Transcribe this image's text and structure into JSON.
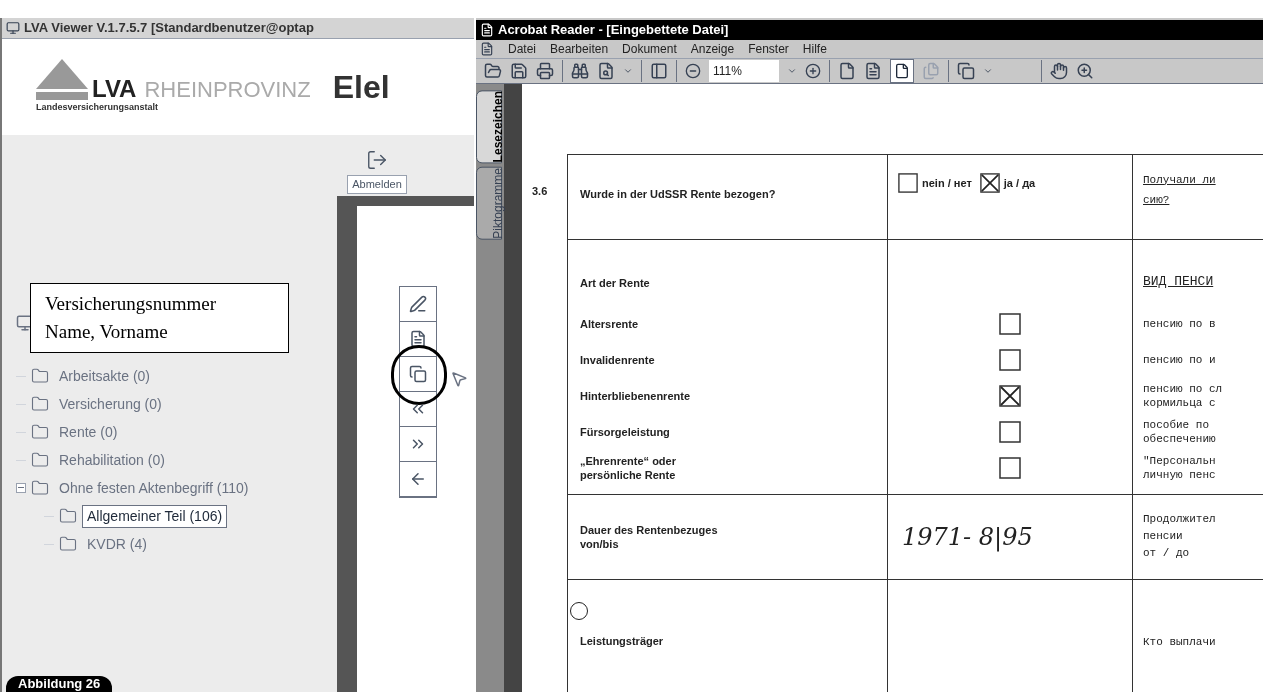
{
  "viewer": {
    "title": "LVA Viewer V.1.7.5.7 [Standardbenutzer@optap",
    "logo": {
      "brand": "LVA",
      "region": "RHEINPROVINZ",
      "subtitle": "Landesversicherungsanstalt"
    },
    "heading": "Elel",
    "logout_button": "Abmelden",
    "annotation": [
      "Versicherungsnummer",
      "Name, Vorname"
    ],
    "tree": [
      {
        "label": "Arbeitsakte (0)",
        "selected": false
      },
      {
        "label": "Versicherung (0)",
        "selected": false
      },
      {
        "label": "Rente (0)",
        "selected": false
      },
      {
        "label": "Rehabilitation (0)",
        "selected": false
      },
      {
        "label": "Ohne festen Aktenbegriff (110)",
        "selected": false,
        "expanded": true,
        "children": [
          {
            "label": "Allgemeiner Teil (106)",
            "selected": true
          },
          {
            "label": "KVDR (4)",
            "selected": false
          }
        ]
      }
    ],
    "tools": [
      {
        "kind": "edit",
        "circled": false
      },
      {
        "kind": "page",
        "circled": false
      },
      {
        "kind": "copy",
        "circled": true
      },
      {
        "kind": "rewind",
        "circled": false
      },
      {
        "kind": "forward",
        "circled": false
      },
      {
        "kind": "back",
        "circled": false
      }
    ]
  },
  "caption": "Abbildung 26",
  "reader": {
    "title": "Acrobat Reader - [Eingebettete Datei]",
    "menu": [
      "Datei",
      "Bearbeiten",
      "Dokument",
      "Anzeige",
      "Fenster",
      "Hilfe"
    ],
    "zoom": "111%",
    "side_tabs": [
      {
        "label": "Lesezeichen",
        "selected": true
      },
      {
        "label": "Piktogramme",
        "selected": false
      }
    ],
    "form": {
      "question": {
        "number": "3.6",
        "text": "Wurde in der UdSSR Rente bezogen?",
        "options": [
          {
            "label": "nein / нет",
            "checked": false
          },
          {
            "label": "ja / да",
            "checked": true
          }
        ],
        "russian": [
          "Получали ли",
          "сию?"
        ]
      },
      "pension_type": {
        "heading": "Art der Rente",
        "russian_heading": "ВИД ПЕНСИ",
        "options": [
          {
            "label": [
              "Altersrente"
            ],
            "checked": false,
            "russian": [
              "пенсию по в"
            ]
          },
          {
            "label": [
              "Invalidenrente"
            ],
            "checked": false,
            "russian": [
              "пенсию по и"
            ]
          },
          {
            "label": [
              "Hinterbliebenenrente"
            ],
            "checked": true,
            "russian": [
              "пенсию по сл",
              "кормильца с"
            ]
          },
          {
            "label": [
              "Fürsorgeleistung"
            ],
            "checked": false,
            "russian": [
              "пособие по",
              "обеспечению"
            ]
          },
          {
            "label": [
              "„Ehrenrente“ oder",
              "persönliche Rente"
            ],
            "checked": false,
            "russian": [
              "\"Персональн",
              "личную пенс"
            ]
          }
        ]
      },
      "duration": {
        "label": [
          "Dauer des Rentenbezuges",
          "von/bis"
        ],
        "handwritten": "1971- 8|95",
        "russian": [
          "Продолжител",
          "пенсии",
          "от / до"
        ]
      },
      "provider": {
        "label": "Leistungsträger",
        "russian": "Кто выплачи"
      }
    }
  }
}
